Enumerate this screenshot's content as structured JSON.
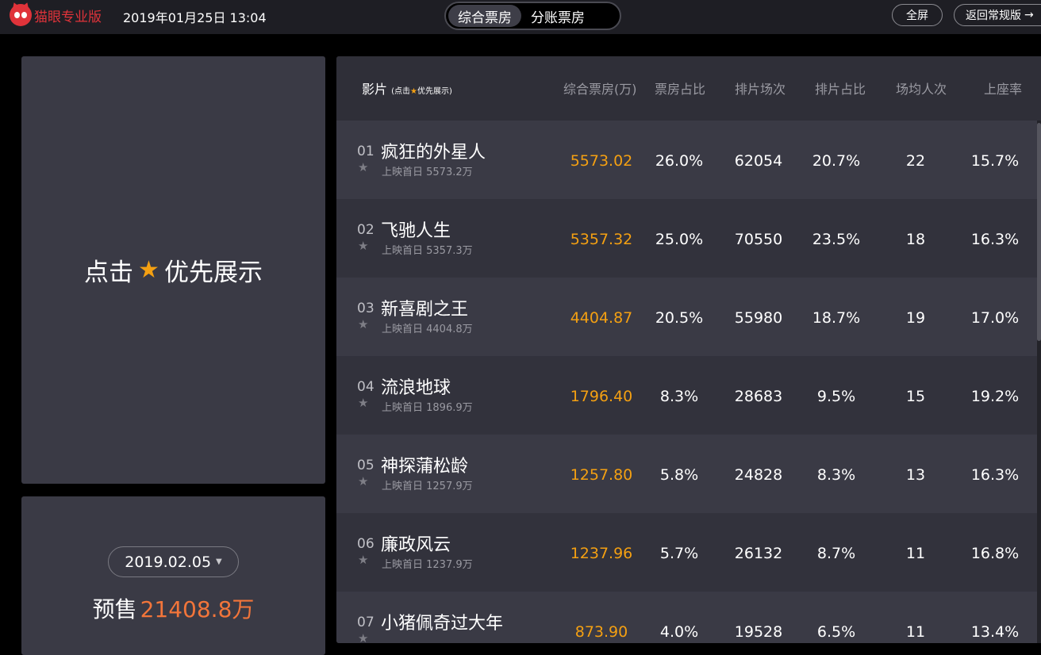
{
  "header": {
    "brand": "猫眼专业版",
    "datetime": "2019年01月25日 13:04",
    "tabs": [
      {
        "label": "综合票房",
        "active": true
      },
      {
        "label": "分账票房",
        "active": false
      }
    ],
    "fullscreen_label": "全屏",
    "back_label": "返回常规版",
    "back_icon": "arrow-right-icon"
  },
  "promo": {
    "text_before": "点击",
    "text_after": "优先展示",
    "icon": "star-icon"
  },
  "presale": {
    "date": "2019.02.05",
    "label": "预售",
    "value": "21408.8万"
  },
  "table": {
    "headers": {
      "film": "影片",
      "film_hint_before": "(点击",
      "film_hint_after": "优先展示)",
      "box": "综合票房(万)",
      "share": "票房占比",
      "shows": "排片场次",
      "show_pct": "排片占比",
      "avg": "场均人次",
      "seat": "上座率"
    },
    "rows": [
      {
        "rank": "01",
        "title": "疯狂的外星人",
        "sub": "上映首日  5573.2万",
        "box": "5573.02",
        "share": "26.0%",
        "shows": "62054",
        "show_pct": "20.7%",
        "avg": "22",
        "seat": "15.7%"
      },
      {
        "rank": "02",
        "title": "飞驰人生",
        "sub": "上映首日  5357.3万",
        "box": "5357.32",
        "share": "25.0%",
        "shows": "70550",
        "show_pct": "23.5%",
        "avg": "18",
        "seat": "16.3%"
      },
      {
        "rank": "03",
        "title": "新喜剧之王",
        "sub": "上映首日  4404.8万",
        "box": "4404.87",
        "share": "20.5%",
        "shows": "55980",
        "show_pct": "18.7%",
        "avg": "19",
        "seat": "17.0%"
      },
      {
        "rank": "04",
        "title": "流浪地球",
        "sub": "上映首日  1896.9万",
        "box": "1796.40",
        "share": "8.3%",
        "shows": "28683",
        "show_pct": "9.5%",
        "avg": "15",
        "seat": "19.2%"
      },
      {
        "rank": "05",
        "title": "神探蒲松龄",
        "sub": "上映首日  1257.9万",
        "box": "1257.80",
        "share": "5.8%",
        "shows": "24828",
        "show_pct": "8.3%",
        "avg": "13",
        "seat": "16.3%"
      },
      {
        "rank": "06",
        "title": "廉政风云",
        "sub": "上映首日  1237.9万",
        "box": "1237.96",
        "share": "5.7%",
        "shows": "26132",
        "show_pct": "8.7%",
        "avg": "11",
        "seat": "16.8%"
      },
      {
        "rank": "07",
        "title": "小猪佩奇过大年",
        "sub": "",
        "box": "873.90",
        "share": "4.0%",
        "shows": "19528",
        "show_pct": "6.5%",
        "avg": "11",
        "seat": "13.4%"
      }
    ]
  },
  "colors": {
    "background": "#000000",
    "topbar": "#1e1e24",
    "card": "#3a3a45",
    "row_alt": "#32323c",
    "accent_orange": "#f4a012",
    "presale_orange": "#f2753a",
    "brand_red": "#e0333a"
  }
}
